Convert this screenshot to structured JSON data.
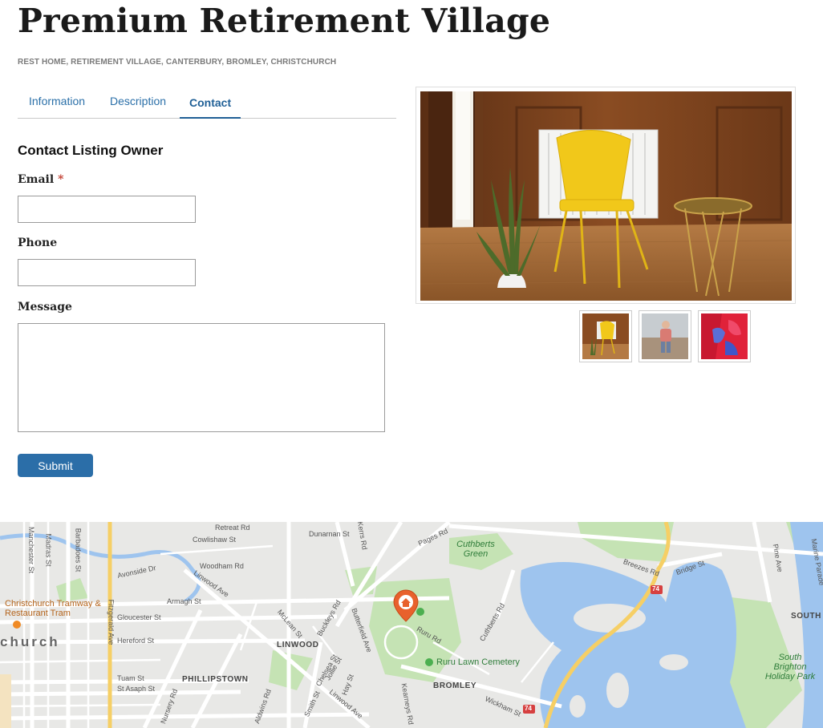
{
  "listing": {
    "title": "Premium Retirement Village",
    "categories": [
      "REST HOME",
      "RETIREMENT VILLAGE",
      "CANTERBURY",
      "BROMLEY",
      "CHRISTCHURCH"
    ]
  },
  "tabs": [
    {
      "label": "Information",
      "active": false
    },
    {
      "label": "Description",
      "active": false
    },
    {
      "label": "Contact",
      "active": true
    }
  ],
  "contact_form": {
    "heading": "Contact Listing Owner",
    "email_label": "Email",
    "required_mark": "*",
    "email_value": "",
    "phone_label": "Phone",
    "phone_value": "",
    "message_label": "Message",
    "message_value": "",
    "submit_label": "Submit"
  },
  "gallery": {
    "main_image": "yellow-chair-room-photo",
    "thumbnails": [
      "yellow-chair-room-thumbnail",
      "beach-walker-thumbnail",
      "colorful-fabric-thumbnail"
    ]
  },
  "map": {
    "streets": [
      "Retreat Rd",
      "Dunarnan St",
      "Kerrs Rd",
      "Pages Rd",
      "Cowlishaw St",
      "Woodham Rd",
      "Avonside Dr",
      "Linwood Ave",
      "Armagh St",
      "Gloucester St",
      "Hereford St",
      "Tuam St",
      "St Asaph St",
      "Fitzgerald Ave",
      "Madras St",
      "Barbadoes St",
      "Manchester St",
      "Buckleys Rd",
      "Butterfield Ave",
      "McLean St",
      "Ruru Rd",
      "Cuthberts Rd",
      "Breezes Rd",
      "Bridge St",
      "Pine Ave",
      "Marine Parade",
      "Chelsea St",
      "Jollie St",
      "Hay St",
      "Smith St",
      "Aldwins Rd",
      "Nursery Rd",
      "Wickham St",
      "Kearneys Rd",
      "Linwood Ave"
    ],
    "places": [
      "Cuthberts Green",
      "Christchurch Tramway & Restaurant Tram",
      "Ruru Lawn Cemetery",
      "South Brighton Holiday Park"
    ],
    "suburbs": [
      "LINWOOD",
      "PHILLIPSTOWN",
      "BROMLEY",
      "SOUTH BRIGHT",
      "church"
    ],
    "highway": "74",
    "marker_icon": "home-marker-icon",
    "colors": {
      "water": "#9ec4ee",
      "park": "#c5e3b4",
      "road": "#ffffff",
      "highway": "#f6cf65",
      "marker": "#e8612c"
    }
  },
  "theme": {
    "accent": "#2b6ea8",
    "tab_text": "#2a6fa8"
  }
}
